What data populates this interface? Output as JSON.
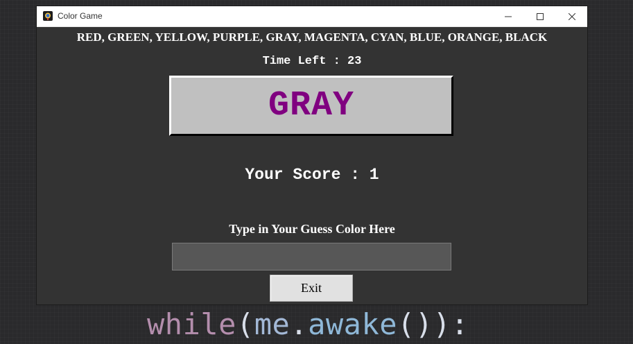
{
  "window": {
    "title": "Color Game",
    "icon": "app-icon",
    "controls": {
      "minimize_icon": "minimize-icon",
      "maximize_icon": "maximize-icon",
      "close_icon": "close-icon"
    }
  },
  "game": {
    "color_list": "RED, GREEN, YELLOW, PURPLE, GRAY, MAGENTA, CYAN, BLUE, ORANGE, BLACK",
    "time_left": "Time Left : 23",
    "word": "GRAY",
    "word_color": "#800080",
    "score": "Your Score : 1",
    "prompt": "Type in Your Guess Color Here",
    "guess_value": "",
    "exit_label": "Exit"
  },
  "background": {
    "code_tokens": {
      "kw": "while",
      "open": "(",
      "obj": "me",
      "dot": ".",
      "fn": "awake",
      "call": "()",
      "close": "):"
    }
  },
  "colors": {
    "window_bg": "#333333",
    "word_box_bg": "#c0c0c0",
    "input_bg": "#575757",
    "button_bg": "#e1e1e1"
  }
}
